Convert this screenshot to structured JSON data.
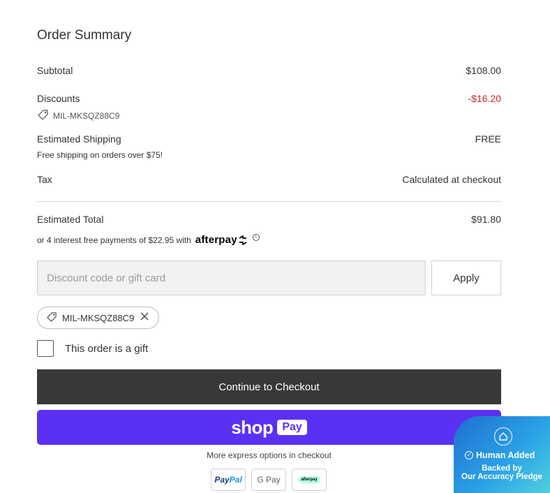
{
  "order_summary": {
    "title": "Order Summary",
    "subtotal": {
      "label": "Subtotal",
      "value": "$108.00"
    },
    "discounts": {
      "label": "Discounts",
      "value": "-$16.20",
      "code": "MIL-MKSQZ88C9"
    },
    "shipping": {
      "label": "Estimated Shipping",
      "value": "FREE",
      "note": "Free shipping on orders over $75!"
    },
    "tax": {
      "label": "Tax",
      "value": "Calculated at checkout"
    },
    "total": {
      "label": "Estimated Total",
      "value": "$91.80"
    },
    "afterpay": {
      "text": "or 4 interest free payments of $22.95 with",
      "logo": "afterpay"
    }
  },
  "discount_form": {
    "placeholder": "Discount code or gift card",
    "apply_label": "Apply",
    "applied_code": "MIL-MKSQZ88C9"
  },
  "gift": {
    "label": "This order is a gift",
    "checked": false
  },
  "checkout": {
    "label": "Continue to Checkout"
  },
  "shop_pay": {
    "shop": "shop",
    "pay": "Pay"
  },
  "express": {
    "text": "More express options in checkout",
    "methods": {
      "paypal_a": "Pay",
      "paypal_b": "Pal",
      "gpay": "G Pay",
      "afterpay": "afterpay"
    }
  },
  "badge": {
    "title": "Human Added",
    "line1": "Backed by",
    "line2": "Our Accuracy Pledge"
  },
  "colors": {
    "discount_red": "#d0262a",
    "checkout_bg": "#383838",
    "shop_pay_purple": "#5a31f4"
  }
}
